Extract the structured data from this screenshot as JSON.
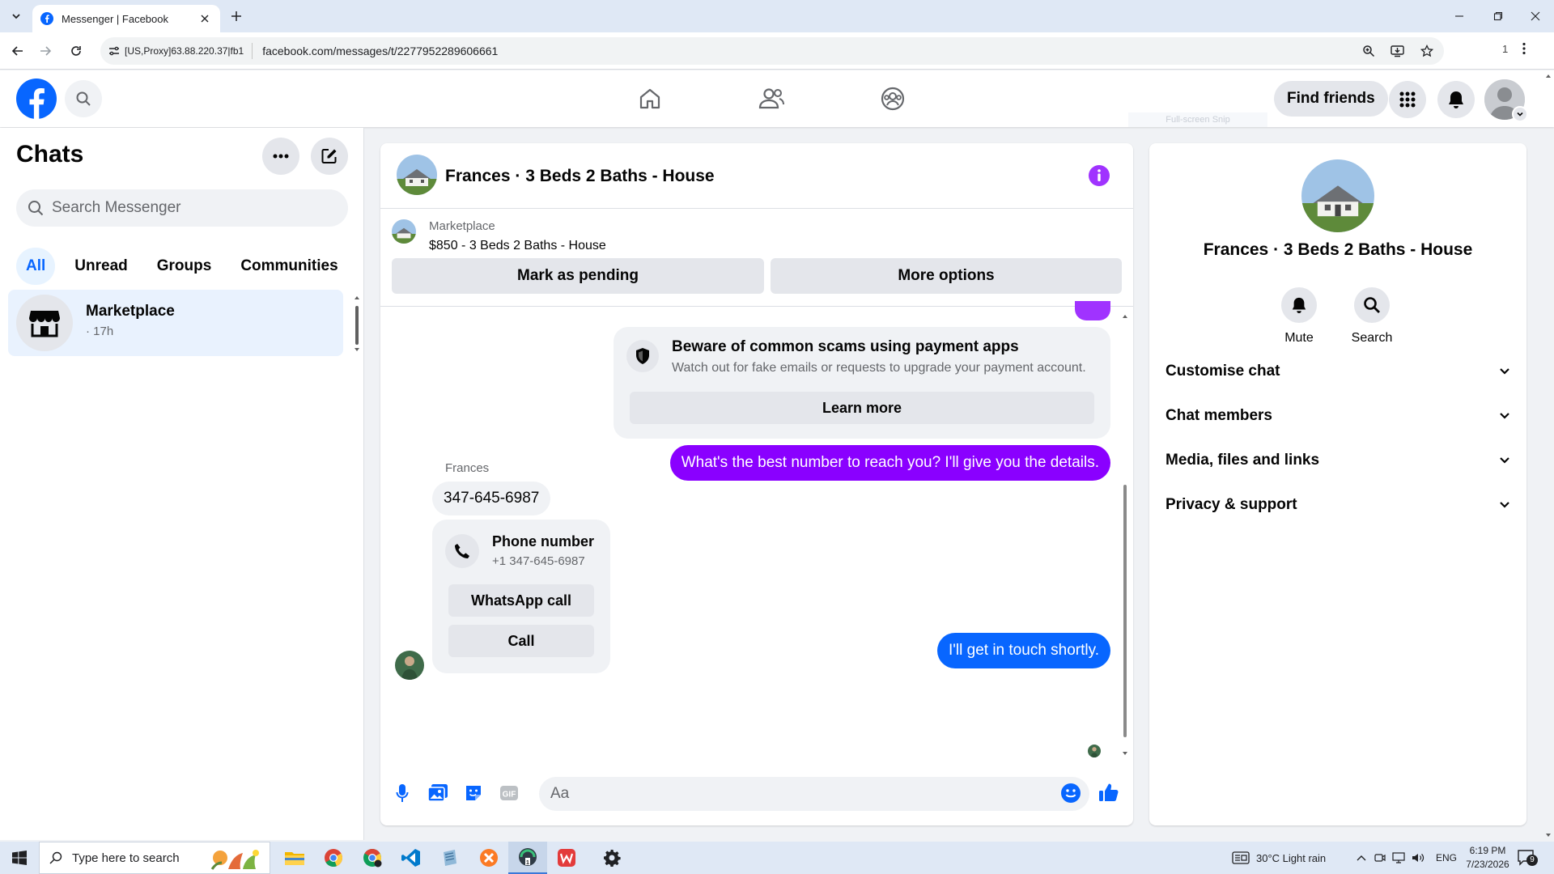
{
  "browser": {
    "tab_title": "Messenger | Facebook",
    "proxy_label": "[US,Proxy]63.88.220.37|fb1",
    "url": "facebook.com/messages/t/2277952289606661",
    "extension_count": "1"
  },
  "header": {
    "find_friends_label": "Find friends",
    "snip_ghost": "Full-screen Snip"
  },
  "left": {
    "title": "Chats",
    "search_placeholder": "Search Messenger",
    "filters": [
      "All",
      "Unread",
      "Groups",
      "Communities"
    ],
    "chat": {
      "name": "Marketplace",
      "time": "· 17h"
    }
  },
  "conversation": {
    "title": "Frances · 3 Beds 2 Baths - House",
    "marketplace_label": "Marketplace",
    "listing_title": "$850 - 3 Beds 2 Baths - House",
    "mark_pending_label": "Mark as pending",
    "more_options_label": "More options",
    "scam_title": "Beware of common scams using payment apps",
    "scam_sub": "Watch out for fake emails or requests to upgrade your payment account.",
    "learn_more_label": "Learn more",
    "msg_out_1": "What's the best number to reach you? I'll give you the details.",
    "sender_name": "Frances",
    "msg_in_1": "347-645-6987",
    "phone_card_title": "Phone number",
    "phone_card_number": "+1 347-645-6987",
    "whatsapp_label": "WhatsApp call",
    "call_label": "Call",
    "msg_out_2": "I'll get in touch shortly.",
    "composer_placeholder": "Aa",
    "colors": {
      "purple_bubble": "#8a00ff",
      "blue_bubble": "#0866ff"
    }
  },
  "right": {
    "title": "Frances · 3 Beds 2 Baths - House",
    "mute_label": "Mute",
    "search_label": "Search",
    "sections": [
      "Customise chat",
      "Chat members",
      "Media, files and links",
      "Privacy & support"
    ]
  },
  "taskbar": {
    "search_placeholder": "Type here to search",
    "weather": "30°C  Light rain",
    "language": "ENG",
    "time": "6:19 PM",
    "date": "7/23/2026",
    "notification_count": "9"
  }
}
